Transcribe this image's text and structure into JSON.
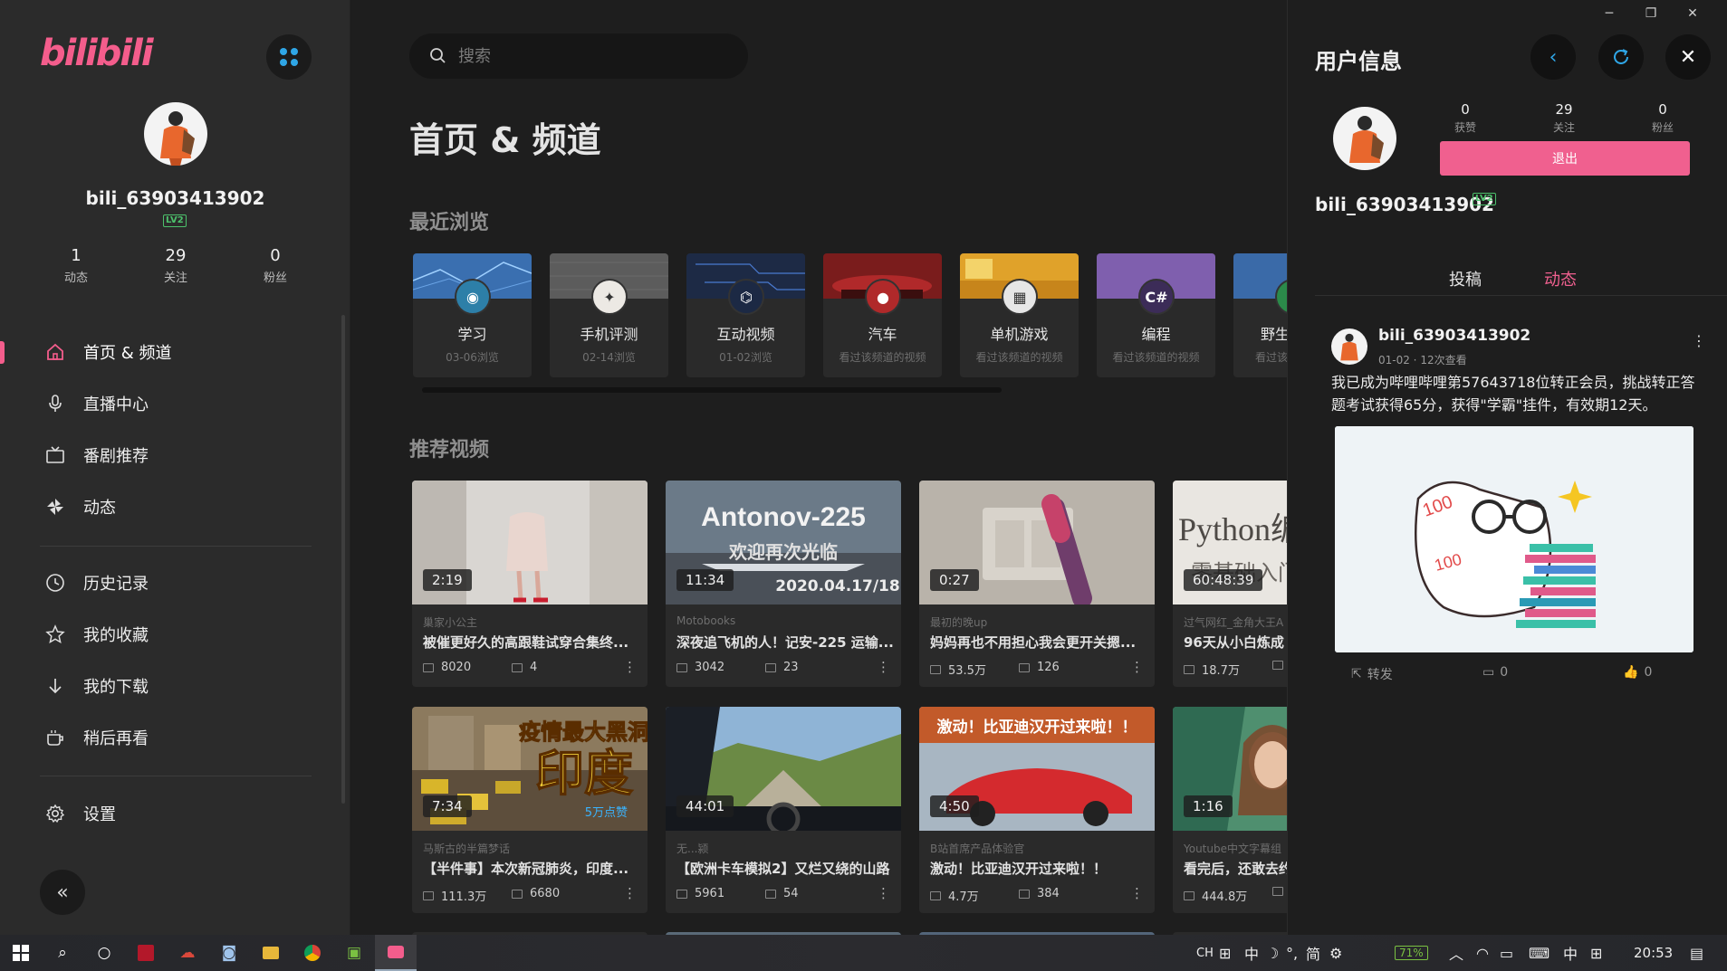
{
  "app": {
    "logo": "bilibili"
  },
  "sidebar": {
    "username": "bili_63903413902",
    "level": "LV2",
    "stats": [
      {
        "value": "1",
        "label": "动态"
      },
      {
        "value": "29",
        "label": "关注"
      },
      {
        "value": "0",
        "label": "粉丝"
      }
    ],
    "nav": [
      {
        "label": "首页 & 频道",
        "icon": "home-icon",
        "active": true
      },
      {
        "label": "直播中心",
        "icon": "microphone-icon"
      },
      {
        "label": "番剧推荐",
        "icon": "tv-icon"
      },
      {
        "label": "动态",
        "icon": "pinwheel-icon"
      },
      {
        "label": "历史记录",
        "icon": "clock-icon"
      },
      {
        "label": "我的收藏",
        "icon": "star-icon"
      },
      {
        "label": "我的下载",
        "icon": "download-icon"
      },
      {
        "label": "稍后再看",
        "icon": "cup-icon"
      },
      {
        "label": "设置",
        "icon": "gear-icon"
      }
    ],
    "collapse": "«"
  },
  "main": {
    "search_placeholder": "搜索",
    "page_title": "首页 & 频道",
    "recent_title": "最近浏览",
    "recommend_title": "推荐视频",
    "channels": [
      {
        "name": "学习",
        "sub": "03-06浏览"
      },
      {
        "name": "手机评测",
        "sub": "02-14浏览"
      },
      {
        "name": "互动视频",
        "sub": "01-02浏览"
      },
      {
        "name": "汽车",
        "sub": "看过该频道的视频"
      },
      {
        "name": "单机游戏",
        "sub": "看过该频道的视频"
      },
      {
        "name": "编程",
        "sub": "看过该频道的视频",
        "glyph": "C#"
      },
      {
        "name": "野生技",
        "sub": "看过该"
      }
    ],
    "videos": [
      {
        "duration": "2:19",
        "up": "巢家小公主",
        "title": "被催更好久的高跟鞋试穿合集终...",
        "plays": "8020",
        "danmaku": "4"
      },
      {
        "duration": "11:34",
        "up": "Motobooks",
        "title": "深夜追飞机的人！记安-225 运输...",
        "plays": "3042",
        "danmaku": "23",
        "thumb_text_1": "Antonov-225",
        "thumb_text_2": "欢迎再次光临",
        "thumb_text_3": "2020.04.17/18"
      },
      {
        "duration": "0:27",
        "up": "最初的晚up",
        "title": "妈妈再也不用担心我会更开关摁...",
        "plays": "53.5万",
        "danmaku": "126"
      },
      {
        "duration": "60:48:39",
        "up": "过气网红_金角大王A",
        "title": "96天从小白炼成",
        "plays": "18.7万",
        "danmaku": "",
        "thumb_text_1": "Python编",
        "thumb_text_2": "零基础入门"
      },
      {
        "duration": "7:34",
        "up": "马斯古的半篇梦话",
        "title": "【半件事】本次新冠肺炎，印度...",
        "plays": "111.3万",
        "danmaku": "6680",
        "badge": "5万点赞",
        "thumb_text_1": "疫情最大黑洞",
        "thumb_text_2": "印度"
      },
      {
        "duration": "44:01",
        "up": "无...颍",
        "title": "【欧洲卡车模拟2】又烂又绕的山路",
        "plays": "5961",
        "danmaku": "54"
      },
      {
        "duration": "4:50",
        "up": "B站首席产品体验官",
        "title": "激动！比亚迪汉开过来啦！！",
        "plays": "4.7万",
        "danmaku": "384",
        "thumb_text_1": "激动！比亚迪汉开过来啦！！"
      },
      {
        "duration": "1:16",
        "up": "Youtube中文字幕组",
        "title": "看完后，还敢去约",
        "plays": "444.8万",
        "danmaku": ""
      }
    ]
  },
  "panel": {
    "title": "用户信息",
    "stats": [
      {
        "value": "0",
        "label": "获赞"
      },
      {
        "value": "29",
        "label": "关注"
      },
      {
        "value": "0",
        "label": "粉丝"
      }
    ],
    "logout": "退出",
    "username": "bili_63903413902",
    "level": "LV2",
    "tabs": [
      {
        "label": "投稿"
      },
      {
        "label": "动态",
        "active": true
      }
    ],
    "post": {
      "author": "bili_63903413902",
      "meta": "01-02 · 12次查看",
      "text": "我已成为哔哩哔哩第57643718位转正会员，挑战转正答题考试获得65分，获得\"学霸\"挂件，有效期12天。",
      "forward": "转发",
      "comments": "0",
      "likes": "0"
    },
    "accent": "#f0608f"
  },
  "taskbar": {
    "tray": [
      "CH",
      "中",
      "简"
    ],
    "battery": "71%",
    "ime": "中",
    "time": "20:53"
  }
}
